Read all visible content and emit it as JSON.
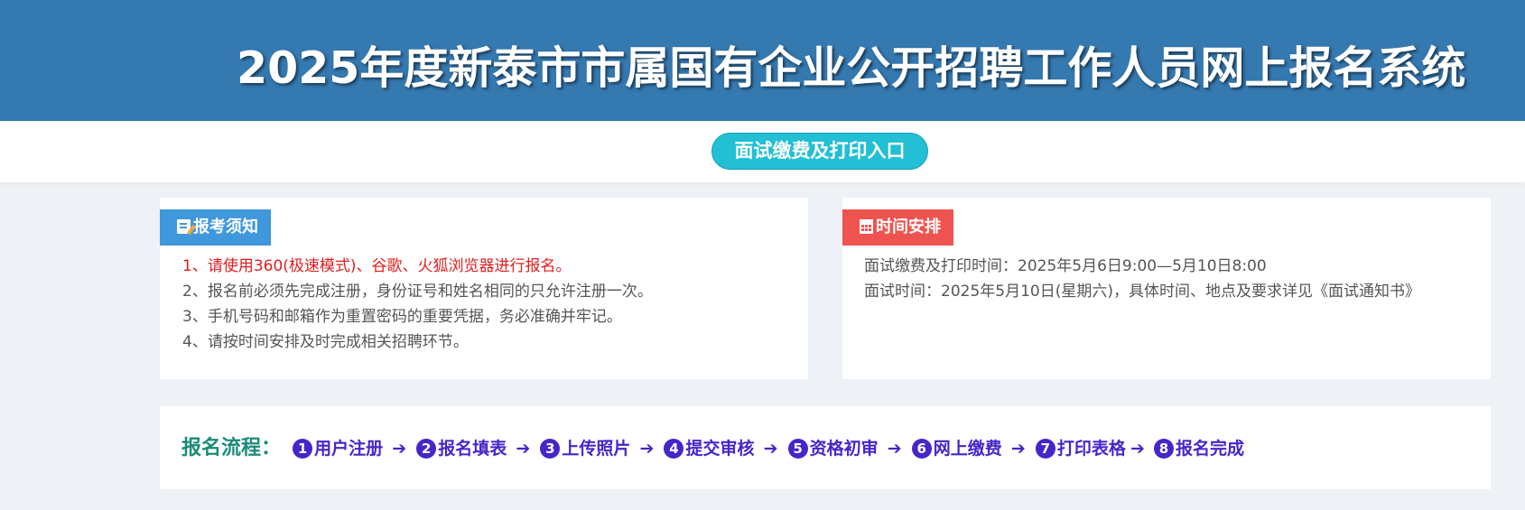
{
  "header": {
    "title": "2025年度新泰市市属国有企业公开招聘工作人员网上报名系统"
  },
  "banner": {
    "entry_button": "面试缴费及打印入口"
  },
  "notice": {
    "tag": "报考须知",
    "icon": "pencil-icon",
    "lines": [
      "1、请使用360(极速模式)、谷歌、火狐浏览器进行报名。",
      "2、报名前必须先完成注册，身份证号和姓名相同的只允许注册一次。",
      "3、手机号码和邮箱作为重置密码的重要凭据，务必准确并牢记。",
      "4、请按时间安排及时完成相关招聘环节。"
    ]
  },
  "schedule": {
    "tag": "时间安排",
    "icon": "calendar-icon",
    "lines": [
      "面试缴费及打印时间：2025年5月6日9:00—5月10日8:00",
      "面试时间：2025年5月10日(星期六)，具体时间、地点及要求详见《面试通知书》"
    ]
  },
  "flow": {
    "label": "报名流程：",
    "arrow": "➔",
    "steps": [
      {
        "num": "1",
        "label": "用户注册"
      },
      {
        "num": "2",
        "label": "报名填表"
      },
      {
        "num": "3",
        "label": "上传照片"
      },
      {
        "num": "4",
        "label": "提交审核"
      },
      {
        "num": "5",
        "label": "资格初审"
      },
      {
        "num": "6",
        "label": "网上缴费"
      },
      {
        "num": "7",
        "label": "打印表格"
      },
      {
        "num": "8",
        "label": "报名完成"
      }
    ]
  },
  "colors": {
    "header_bg": "#3579b1",
    "entry_button": "#23bfd4",
    "notice_tag": "#3f97dc",
    "schedule_tag": "#ef5350",
    "warning_text": "#e02020",
    "flow_label": "#1b8b78",
    "flow_step": "#4526c8"
  }
}
